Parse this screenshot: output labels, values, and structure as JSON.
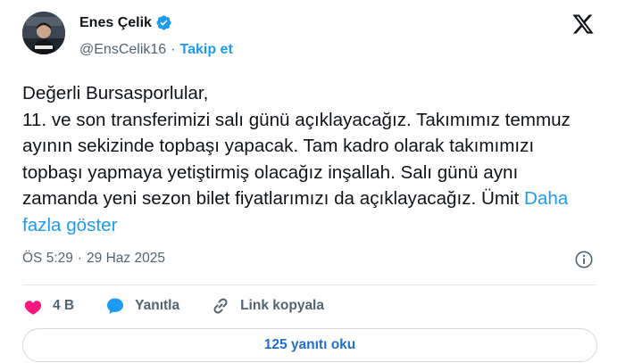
{
  "author": {
    "display_name": "Enes Çelik",
    "handle": "@EnsCelik16",
    "separator": "·",
    "follow_label": "Takip et",
    "verified_color": "#1d9bf0"
  },
  "tweet": {
    "text": "Değerli Bursasporlular,\n11. ve son transferimizi salı günü açıklayacağız. Takımımız temmuz ayının sekizinde topbaşı yapacak. Tam kadro olarak takımımızı topbaşı yapmaya yetiştirmiş olacağız inşallah. Salı günü aynı zamanda yeni sezon bilet fiyatlarımızı da açıklayacağız. Ümit",
    "show_more": "Daha fazla göster",
    "time": "ÖS 5:29",
    "date_separator": "·",
    "date": "29 Haz 2025"
  },
  "actions": {
    "like_count": "4 B",
    "reply_label": "Yanıtla",
    "copy_link_label": "Link kopyala"
  },
  "replies_button": "125 yanıtı oku",
  "colors": {
    "accent": "#1d9bf0",
    "like": "#f91880",
    "reply_bubble": "#1d9bf0",
    "muted": "#536471"
  },
  "icons": [
    "verified-badge-icon",
    "x-logo-icon",
    "info-icon",
    "heart-icon",
    "reply-bubble-icon",
    "link-icon"
  ]
}
